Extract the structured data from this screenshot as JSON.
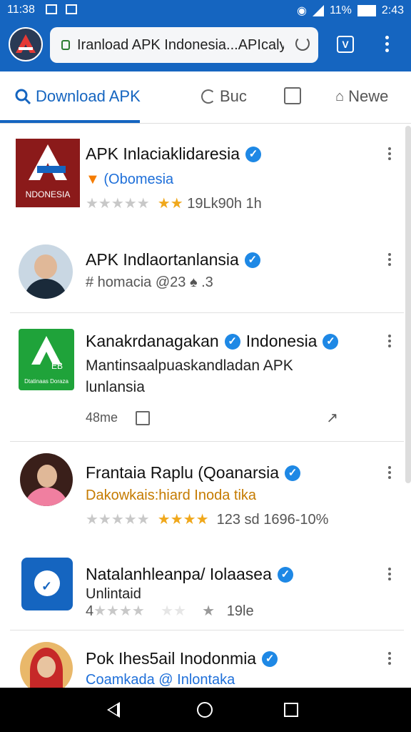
{
  "status": {
    "time": "11:38",
    "battery": "11%",
    "battery2": "2:43"
  },
  "url": {
    "text": "Iranload APK Indonesia...APIcaly"
  },
  "tabs": [
    {
      "label": "Download APK"
    },
    {
      "label": "Buc"
    },
    {
      "label": ""
    },
    {
      "label": "Newe"
    }
  ],
  "items": [
    {
      "title": "APK Inlaciaklidaresia",
      "sub": "(Obomesia",
      "rating": "19Lk90h 1h",
      "thumb_text": "NDONESIA"
    },
    {
      "title": "APK Indlaortanlansia",
      "sub": "# homacia @23 ♠ .3"
    },
    {
      "title": "Kanakrdanagakan",
      "title2": "Indonesia",
      "desc1": "Mantinsaalpuaskandladan APK",
      "desc2": "lunlansia",
      "meta": "48me",
      "thumb_text": "Dtatinaas Doraza"
    },
    {
      "title": "Frantaia Raplu (Qoanarsia",
      "sub": "Dakowkais:hiard Inoda tika",
      "rating": "123 sd 1696-10%"
    },
    {
      "title": "Natalanhleanpa/ Iolaasea",
      "sub": "Unlintaid",
      "rating": "19le",
      "prefix": "4"
    },
    {
      "title": "Pok Ihes5ail Inodonmia",
      "sub": "Coamkada @ Inlontaka"
    }
  ]
}
